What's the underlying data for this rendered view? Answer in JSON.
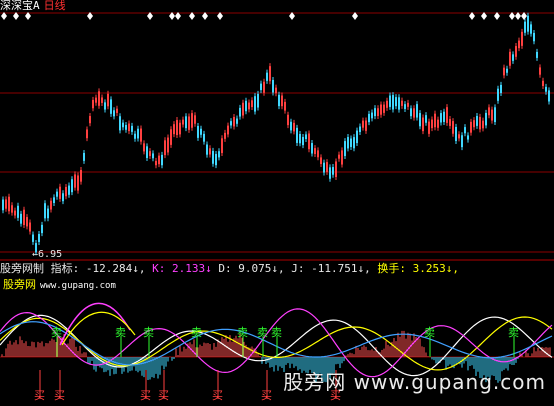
{
  "header": {
    "title": "深深宝A",
    "period": "日线"
  },
  "price_panel": {
    "low_label": "6.95",
    "colors": {
      "up": "#ff4040",
      "down": "#40d8ff",
      "grid": "#8b0000"
    }
  },
  "indicator_bar": {
    "name": "股旁网制",
    "zhibiao_label": "指标:",
    "zhibiao_value": "-12.284",
    "k_label": "K:",
    "k_value": "2.133",
    "d_label": "D:",
    "d_value": "9.075",
    "j_label": "J:",
    "j_value": "-11.751",
    "hs_label": "换手:",
    "hs_value": "3.253",
    "arrow_down": "↓",
    "sep": ","
  },
  "brand": {
    "name": "股旁网",
    "url": "www.gupang.com"
  },
  "signals": {
    "sell": "卖",
    "buy": "买"
  },
  "watermark": "股旁网 www.gupang.com"
}
